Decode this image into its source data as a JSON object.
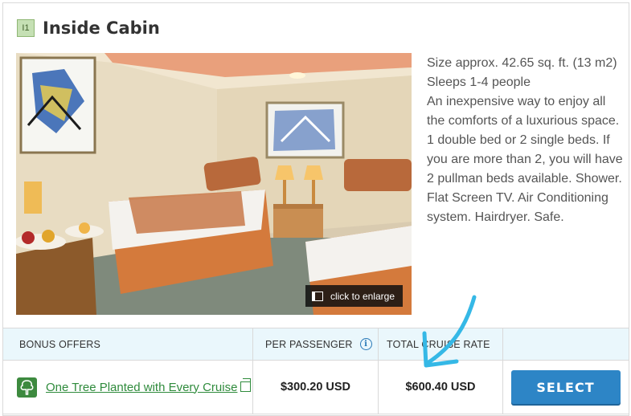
{
  "cabin": {
    "code": "I1",
    "title": "Inside Cabin",
    "enlarge_label": "click to enlarge",
    "description": "Size approx. 42.65 sq. ft. (13 m2)\nSleeps 1-4 people\nAn inexpensive way to enjoy all the comforts of a luxurious space. 1 double bed or 2 single beds. If you are more than 2, you will have 2 pullman beds available. Shower. Flat Screen TV. Air Conditioning system. Hairdryer. Safe."
  },
  "offers_table": {
    "headers": {
      "bonus_offers": "BONUS OFFERS",
      "per_passenger": "PER PASSENGER",
      "total_cruise_rate": "TOTAL CRUISE RATE"
    },
    "row": {
      "offer_text": "One Tree Planted with Every Cruise",
      "per_passenger": "$300.20 USD",
      "total_rate": "$600.40 USD",
      "select_label": "SELECT"
    }
  },
  "colors": {
    "accent": "#2d85c6",
    "offer_link": "#2f8b3c",
    "header_bg": "#eaf7fc",
    "annotation_arrow": "#35b8e6"
  },
  "icons": [
    "info-icon",
    "tree-icon",
    "copy-icon",
    "enlarge-icon",
    "annotation-arrow"
  ]
}
